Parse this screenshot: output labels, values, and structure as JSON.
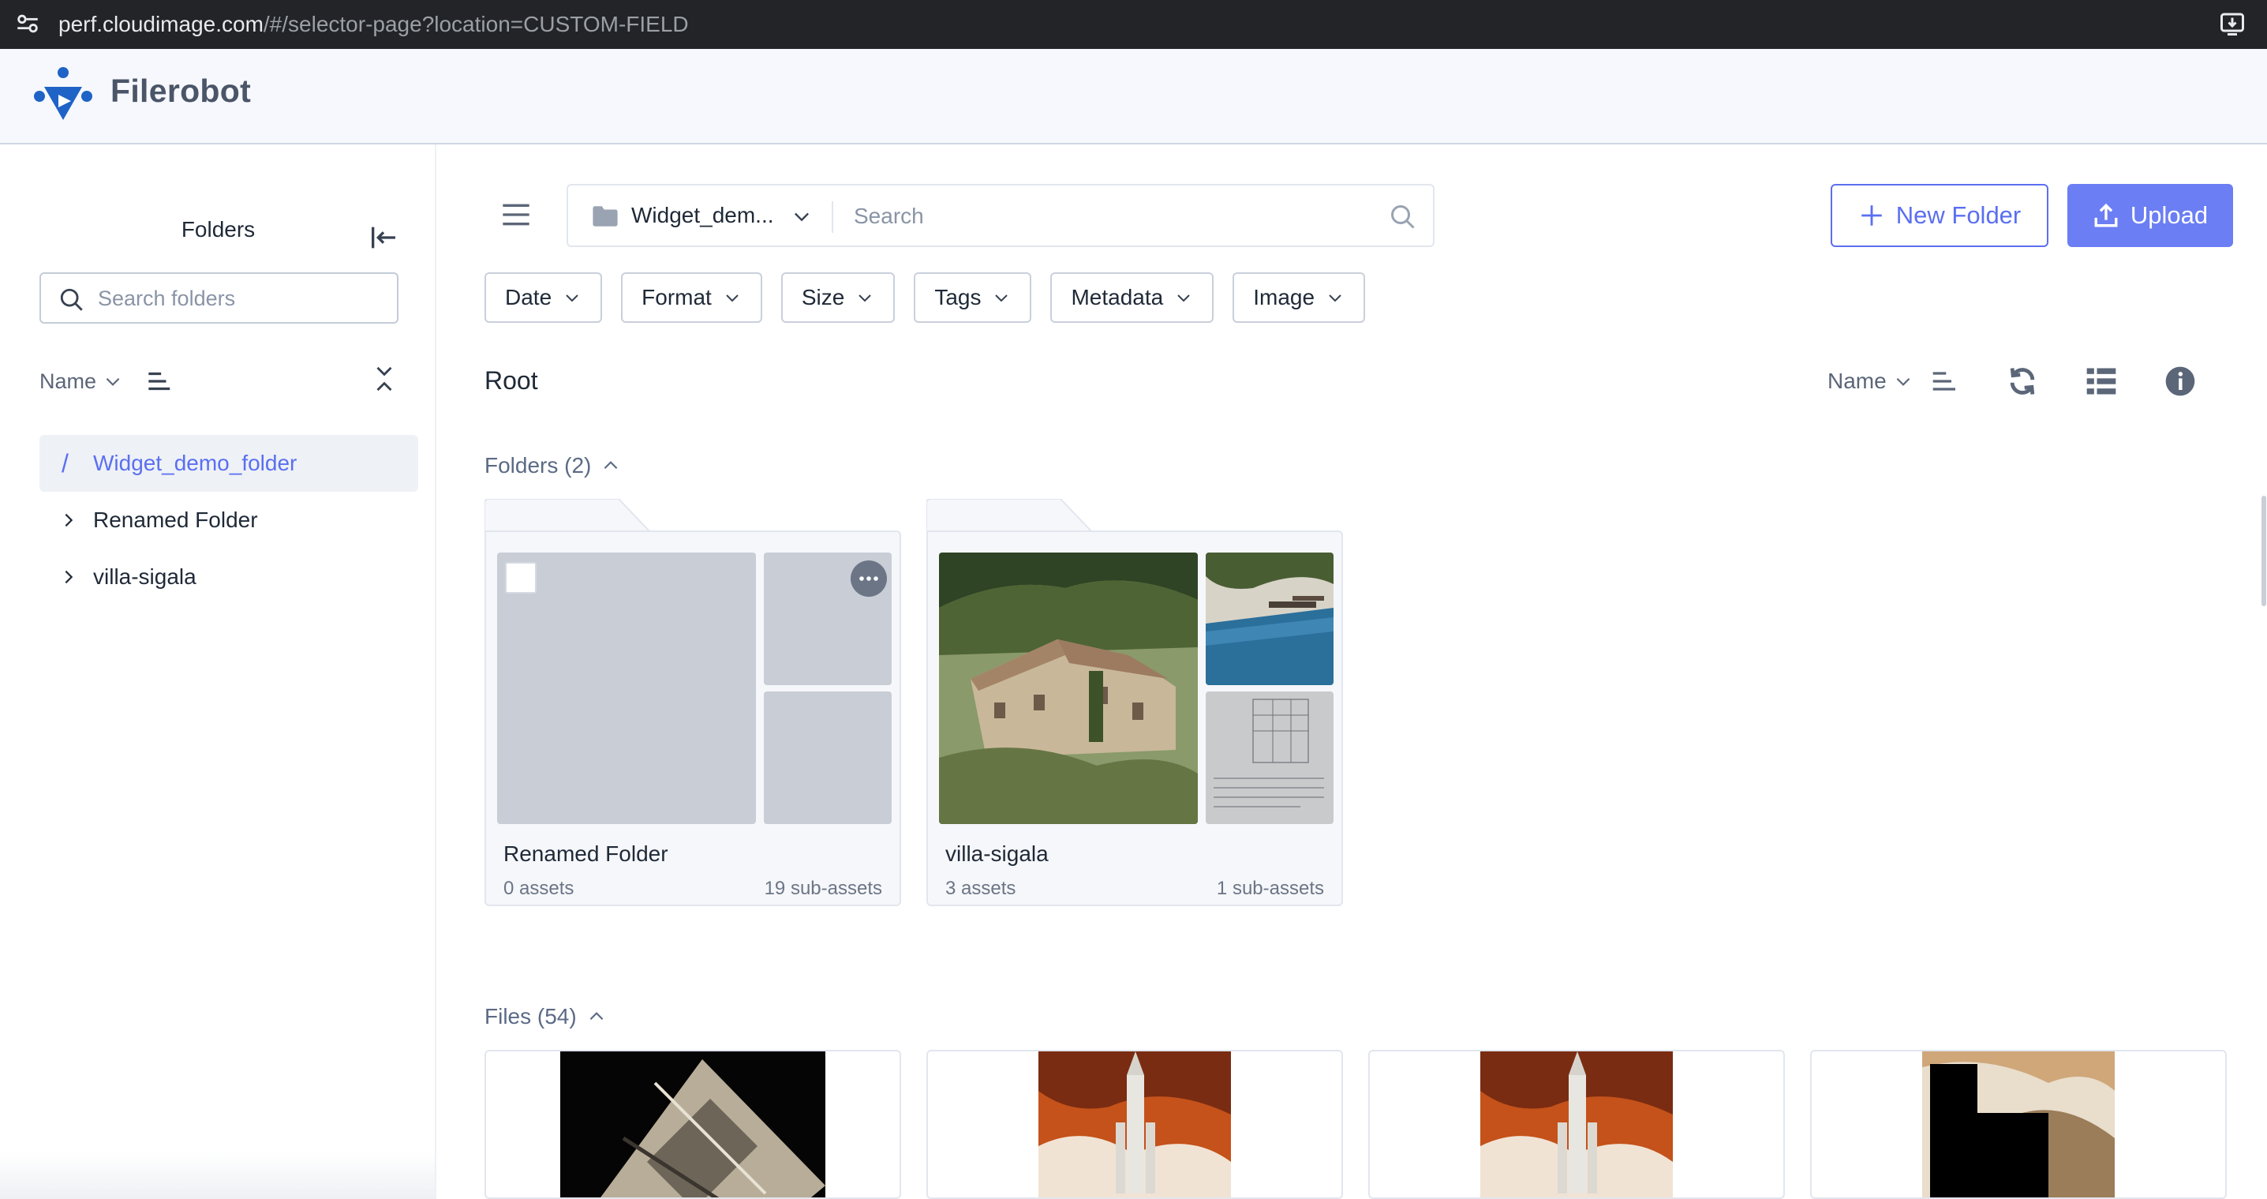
{
  "browser": {
    "url_host": "perf.cloudimage.com",
    "url_path": "/#/selector-page?location=CUSTOM-FIELD"
  },
  "app": {
    "brand": "Filerobot",
    "accent_color": "#5b6ff0"
  },
  "sidebar": {
    "title": "Folders",
    "search_placeholder": "Search folders",
    "sort_label": "Name",
    "tree": [
      {
        "label": "Widget_demo_folder",
        "active": true,
        "prefix": "/"
      },
      {
        "label": "Renamed Folder",
        "active": false
      },
      {
        "label": "villa-sigala",
        "active": false
      }
    ]
  },
  "toolbar": {
    "path_label": "Widget_dem...",
    "search_placeholder": "Search",
    "new_folder_label": "New Folder",
    "upload_label": "Upload",
    "filters": [
      "Date",
      "Format",
      "Size",
      "Tags",
      "Metadata",
      "Image"
    ]
  },
  "main": {
    "location": "Root",
    "sort_label": "Name",
    "folders_heading": "Folders (2)",
    "files_heading": "Files (54)",
    "folders": [
      {
        "name": "Renamed Folder",
        "assets": "0 assets",
        "sub_assets": "19 sub-assets"
      },
      {
        "name": "villa-sigala",
        "assets": "3 assets",
        "sub_assets": "1 sub-assets"
      }
    ],
    "files": [
      {
        "thumb": "rotated-grayscale-photo"
      },
      {
        "thumb": "rocket-launch-photo"
      },
      {
        "thumb": "rocket-launch-photo"
      },
      {
        "thumb": "masked-cloud-photo"
      }
    ]
  },
  "icons": {
    "site_settings": "tune-icon",
    "install": "install-app-icon",
    "menu": "hamburger-icon",
    "folder": "folder-icon",
    "search": "search-icon",
    "refresh": "refresh-icon",
    "list_view": "list-view-icon",
    "info": "info-icon"
  }
}
